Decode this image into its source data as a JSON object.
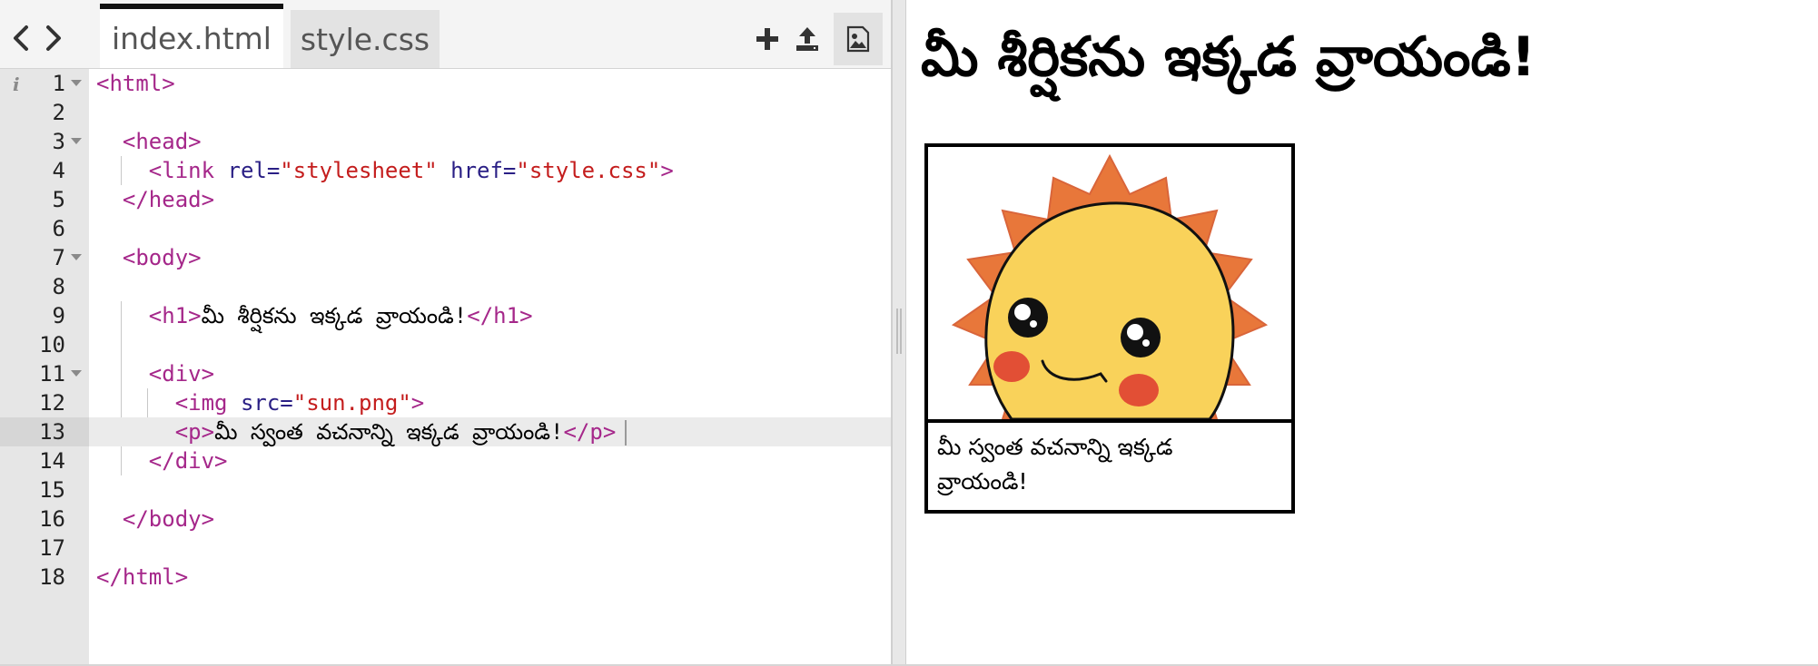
{
  "editor": {
    "tabs": [
      {
        "label": "index.html",
        "active": true
      },
      {
        "label": "style.css",
        "active": false
      }
    ],
    "toolbar": {
      "back_icon": "chevron-left-icon",
      "forward_icon": "chevron-right-icon",
      "add_icon": "plus-icon",
      "upload_icon": "upload-icon",
      "image_icon": "image-icon"
    },
    "active_line": 13,
    "lines": [
      {
        "n": "1"
      },
      {
        "n": "2"
      },
      {
        "n": "3"
      },
      {
        "n": "4"
      },
      {
        "n": "5"
      },
      {
        "n": "6"
      },
      {
        "n": "7"
      },
      {
        "n": "8"
      },
      {
        "n": "9"
      },
      {
        "n": "10"
      },
      {
        "n": "11"
      },
      {
        "n": "12"
      },
      {
        "n": "13"
      },
      {
        "n": "14"
      },
      {
        "n": "15"
      },
      {
        "n": "16"
      },
      {
        "n": "17"
      },
      {
        "n": "18"
      }
    ],
    "code": {
      "l1_tag": "<html>",
      "l3_tag": "<head>",
      "l4_open": "<link ",
      "l4_attr1": "rel=",
      "l4_val1": "\"stylesheet\"",
      "l4_attr2": " href=",
      "l4_val2": "\"style.css\"",
      "l4_close": ">",
      "l5_tag": "</head>",
      "l7_tag": "<body>",
      "l9_open": "<h1>",
      "l9_text": "మీ శీర్షికను ఇక్కడ వ్రాయండి!",
      "l9_close": "</h1>",
      "l11_tag": "<div>",
      "l12_open": "<img ",
      "l12_attr": "src=",
      "l12_val": "\"sun.png\"",
      "l12_close": ">",
      "l13_open": "<p>",
      "l13_text": "మీ స్వంత వచనాన్ని ఇక్కడ వ్రాయండి!",
      "l13_close": "</p>",
      "l14_tag": "</div>",
      "l16_tag": "</body>",
      "l18_tag": "</html>"
    }
  },
  "preview": {
    "heading": "మీ శీర్షికను ఇక్కడ వ్రాయండి!",
    "card_text": "మీ స్వంత వచనాన్ని ఇక్కడ వ్రాయండి!",
    "image_icon": "sun-image"
  },
  "colors": {
    "tag": "#a5278a",
    "attribute": "#2a1f85",
    "string": "#c41d1d",
    "sun_rays": "#e8773a",
    "sun_face": "#f9d25a",
    "cheeks": "#e24f35"
  }
}
